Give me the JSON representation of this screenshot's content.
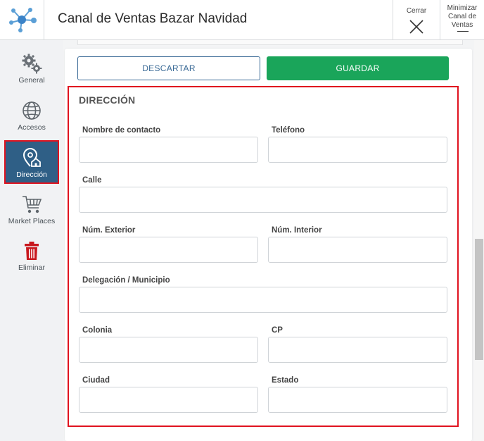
{
  "header": {
    "title": "Canal de Ventas Bazar Navidad",
    "close_label": "Cerrar",
    "minimize_label": "Minimizar Canal de Ventas"
  },
  "sidebar": {
    "items": [
      {
        "label": "General",
        "icon": "gears-icon"
      },
      {
        "label": "Accesos",
        "icon": "globe-icon"
      },
      {
        "label": "Dirección",
        "icon": "location-home-icon",
        "active": true
      },
      {
        "label": "Market Places",
        "icon": "cart-icon"
      },
      {
        "label": "Eliminar",
        "icon": "trash-icon"
      }
    ]
  },
  "actions": {
    "discard_label": "DESCARTAR",
    "save_label": "GUARDAR"
  },
  "section": {
    "title": "DIRECCIÓN",
    "fields": {
      "contacto": {
        "label": "Nombre de contacto",
        "value": ""
      },
      "telefono": {
        "label": "Teléfono",
        "value": ""
      },
      "calle": {
        "label": "Calle",
        "value": ""
      },
      "num_ext": {
        "label": "Núm. Exterior",
        "value": ""
      },
      "num_int": {
        "label": "Núm. Interior",
        "value": ""
      },
      "delegacion": {
        "label": "Delegación / Municipio",
        "value": ""
      },
      "colonia": {
        "label": "Colonia",
        "value": ""
      },
      "cp": {
        "label": "CP",
        "value": ""
      },
      "ciudad": {
        "label": "Ciudad",
        "value": ""
      },
      "estado": {
        "label": "Estado",
        "value": ""
      }
    }
  },
  "colors": {
    "accent": "#2f5f86",
    "save": "#1aa55a",
    "highlight": "#e0131f",
    "delete": "#c8171d"
  }
}
